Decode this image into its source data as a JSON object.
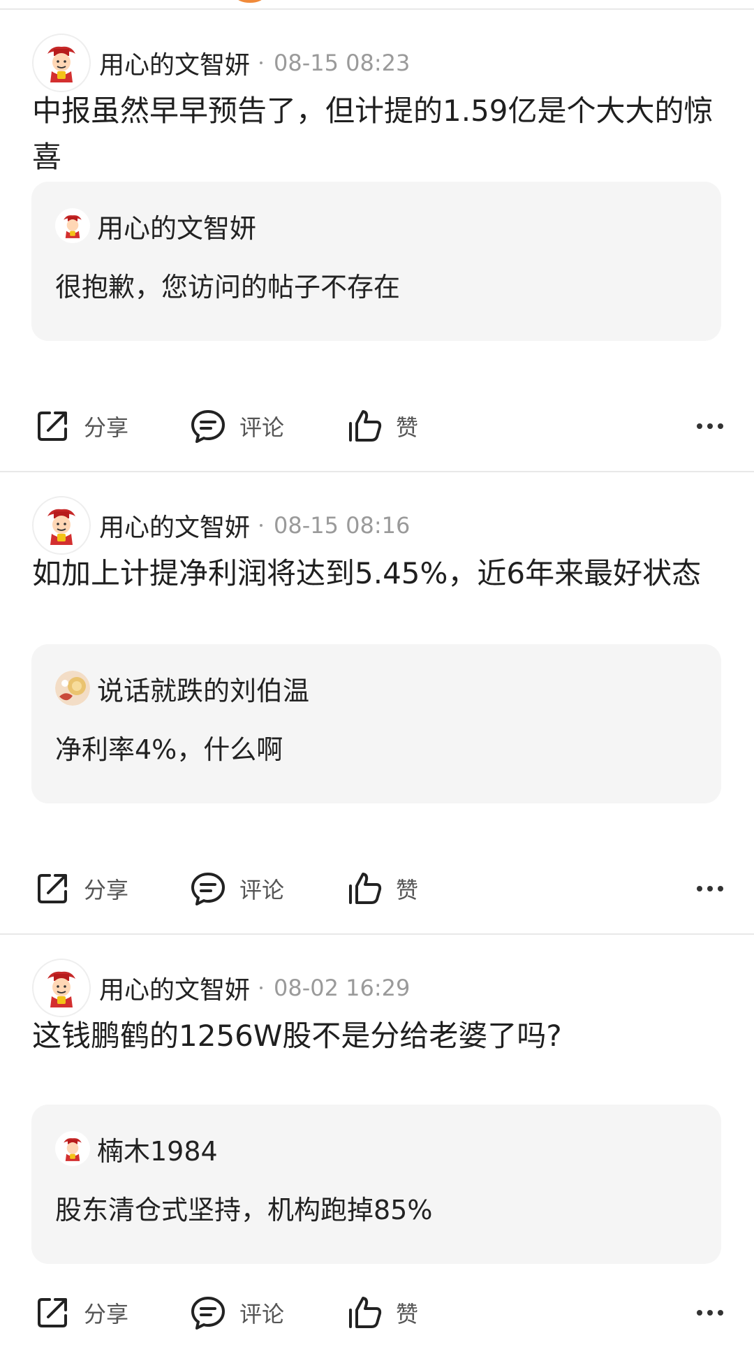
{
  "posts": [
    {
      "author": "用心的文智妍",
      "time": "08-15 08:23",
      "content": "中报虽然早早预告了，但计提的1.59亿是个大大的惊喜",
      "quote": {
        "author": "用心的文智妍",
        "text": "很抱歉，您访问的帖子不存在"
      }
    },
    {
      "author": "用心的文智妍",
      "time": "08-15 08:16",
      "content": "如加上计提净利润将达到5.45%，近6年来最好状态",
      "quote": {
        "author": "说话就跌的刘伯温",
        "text": "净利率4%，什么啊"
      }
    },
    {
      "author": "用心的文智妍",
      "time": "08-02 16:29",
      "content": "这钱鹏鹤的1256W股不是分给老婆了吗?",
      "quote": {
        "author": "楠木1984",
        "text": "股东清仓式坚持，机构跑掉85%"
      }
    }
  ],
  "actions": {
    "share": "分享",
    "comment": "评论",
    "like": "赞"
  },
  "icons": {
    "share": "share-icon",
    "comment": "comment-icon",
    "like": "thumbs-up-icon",
    "more": "more-dots-icon"
  },
  "colors": {
    "text": "#222222",
    "meta": "#9a9a9a",
    "quote_bg": "#f5f5f5",
    "divider": "#e8e8e8"
  }
}
